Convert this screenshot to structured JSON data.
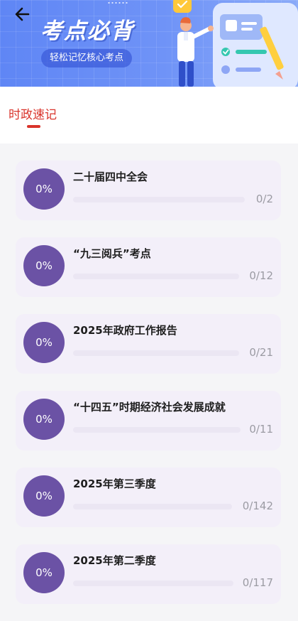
{
  "header": {
    "title": "考点必背",
    "subtitle": "轻松记忆核心考点"
  },
  "tabs": [
    {
      "label": "时政速记",
      "active": true
    }
  ],
  "topics": [
    {
      "progress": "0%",
      "progress_fraction": 0,
      "title": "二十届四中全会",
      "count": "0/2"
    },
    {
      "progress": "0%",
      "progress_fraction": 0,
      "title": "“九三阅兵”考点",
      "count": "0/12"
    },
    {
      "progress": "0%",
      "progress_fraction": 0,
      "title": "2025年政府工作报告",
      "count": "0/21"
    },
    {
      "progress": "0%",
      "progress_fraction": 0,
      "title": "“十四五”时期经济社会发展成就",
      "count": "0/11"
    },
    {
      "progress": "0%",
      "progress_fraction": 0,
      "title": "2025年第三季度",
      "count": "0/142"
    },
    {
      "progress": "0%",
      "progress_fraction": 0,
      "title": "2025年第二季度",
      "count": "0/117"
    }
  ],
  "colors": {
    "accent_red": "#d9342b",
    "progress_purple": "#6b52a5",
    "card_background": "#f3eff9",
    "banner_blue": "#6f93f7"
  },
  "icons": {
    "back": "arrow-left-icon",
    "illustration": "teacher-checklist-illustration"
  }
}
